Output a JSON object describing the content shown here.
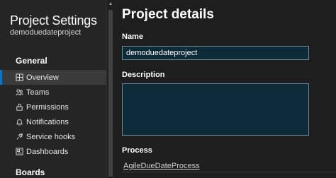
{
  "sidebar": {
    "title": "Project Settings",
    "project": "demoduedateproject",
    "sections": {
      "general": "General",
      "boards": "Boards"
    },
    "items": [
      {
        "label": "Overview",
        "icon": "overview-icon"
      },
      {
        "label": "Teams",
        "icon": "teams-icon"
      },
      {
        "label": "Permissions",
        "icon": "lock-icon"
      },
      {
        "label": "Notifications",
        "icon": "bell-icon"
      },
      {
        "label": "Service hooks",
        "icon": "service-hooks-icon"
      },
      {
        "label": "Dashboards",
        "icon": "dashboards-icon"
      }
    ],
    "selected_item": "Overview"
  },
  "main": {
    "title": "Project details",
    "name_label": "Name",
    "name_value": "demoduedateproject",
    "description_label": "Description",
    "description_value": "",
    "process_label": "Process",
    "process_value": "AgileDueDateProcess"
  },
  "colors": {
    "sidebar_bg": "#252526",
    "main_bg": "#1e1e1e",
    "input_bg": "#0d2a38",
    "selected_bg": "#3b3b3b",
    "accent": "#0078d4"
  }
}
